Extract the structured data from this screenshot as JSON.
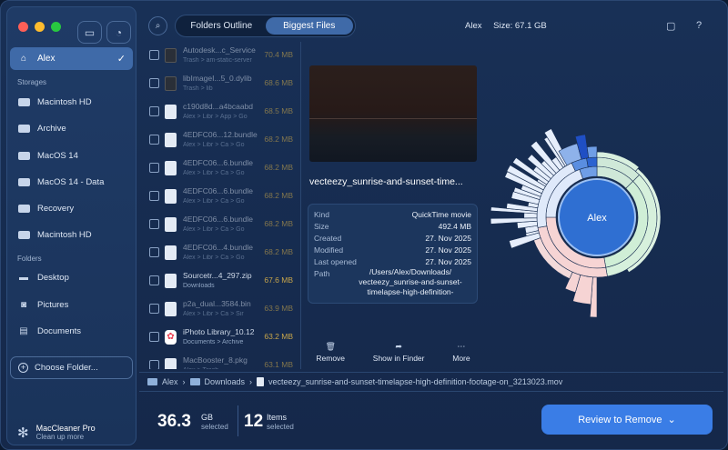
{
  "sidebar": {
    "user": "Alex",
    "storages_heading": "Storages",
    "storages": [
      "Macintosh HD",
      "Archive",
      "MacOS 14",
      "MacOS 14 - Data",
      "Recovery",
      "Macintosh HD"
    ],
    "folders_heading": "Folders",
    "folders": [
      "Desktop",
      "Pictures",
      "Documents"
    ],
    "choose_folder": "Choose Folder...",
    "brand_name": "MacCleaner Pro",
    "brand_tagline": "Clean up more"
  },
  "toolbar": {
    "tabs": [
      "Folders Outline",
      "Biggest Files"
    ],
    "active_tab": "Biggest Files",
    "user": "Alex",
    "size_text": "Size: 67.1 GB"
  },
  "files": [
    {
      "name": "Autodesk...c_Service",
      "path": "Trash > am-static-server",
      "size": "70.4 MB",
      "icon": "dark"
    },
    {
      "name": "libImageI...5_0.dylib",
      "path": "Trash > lib",
      "size": "68.6 MB",
      "icon": "dark"
    },
    {
      "name": "c190d8d...a4bcaabd",
      "path": "Alex > Libr > App > Go",
      "size": "68.5 MB",
      "icon": "doc"
    },
    {
      "name": "4EDFC06...12.bundle",
      "path": "Alex > Libr > Ca > Go",
      "size": "68.2 MB",
      "icon": "doc"
    },
    {
      "name": "4EDFC06...6.bundle",
      "path": "Alex > Libr > Ca > Go",
      "size": "68.2 MB",
      "icon": "doc"
    },
    {
      "name": "4EDFC06...6.bundle",
      "path": "Alex > Libr > Ca > Go",
      "size": "68.2 MB",
      "icon": "doc"
    },
    {
      "name": "4EDFC06...6.bundle",
      "path": "Alex > Libr > Ca > Go",
      "size": "68.2 MB",
      "icon": "doc"
    },
    {
      "name": "4EDFC06...4.bundle",
      "path": "Alex > Libr > Ca > Go",
      "size": "68.2 MB",
      "icon": "doc"
    },
    {
      "name": "Sourcetr...4_297.zip",
      "path": "Downloads",
      "size": "67.6 MB",
      "icon": "doc",
      "bright": true
    },
    {
      "name": "p2a_dual...3584.bin",
      "path": "Alex > Libr > Ca > Sir",
      "size": "63.9 MB",
      "icon": "doc"
    },
    {
      "name": "iPhoto Library_10.12",
      "path": "Documents > Archive",
      "size": "63.2 MB",
      "icon": "photo",
      "bright": true
    },
    {
      "name": "MacBooster_8.pkg",
      "path": "Alex > Trash",
      "size": "63.1 MB",
      "icon": "doc"
    }
  ],
  "detail": {
    "title": "vecteezy_sunrise-and-sunset-time...",
    "props": [
      {
        "k": "Kind",
        "v": "QuickTime movie"
      },
      {
        "k": "Size",
        "v": "492.4 MB"
      },
      {
        "k": "Created",
        "v": "27. Nov 2025"
      },
      {
        "k": "Modified",
        "v": "27. Nov 2025"
      },
      {
        "k": "Last opened",
        "v": "27. Nov 2025"
      },
      {
        "k": "Path",
        "v": ""
      }
    ],
    "path_value": "/Users/Alex/Downloads/ vecteezy_sunrise-and-sunset-timelapse-high-definition-",
    "actions": [
      "Remove",
      "Show in Finder",
      "More"
    ]
  },
  "chart": {
    "center_label": "Alex"
  },
  "breadcrumb": {
    "items": [
      "Alex",
      "Downloads",
      "vecteezy_sunrise-and-sunset-timelapse-high-definition-footage-on_3213023.mov"
    ]
  },
  "footer": {
    "gb_value": "36.3",
    "gb_unit": "GB",
    "gb_sub": "selected",
    "items_value": "12",
    "items_unit": "Items",
    "items_sub": "selected",
    "review_label": "Review to Remove"
  },
  "colors": {
    "accent": "#3a7de6",
    "active": "#3f6aa8",
    "size_text": "#c9a64a"
  }
}
